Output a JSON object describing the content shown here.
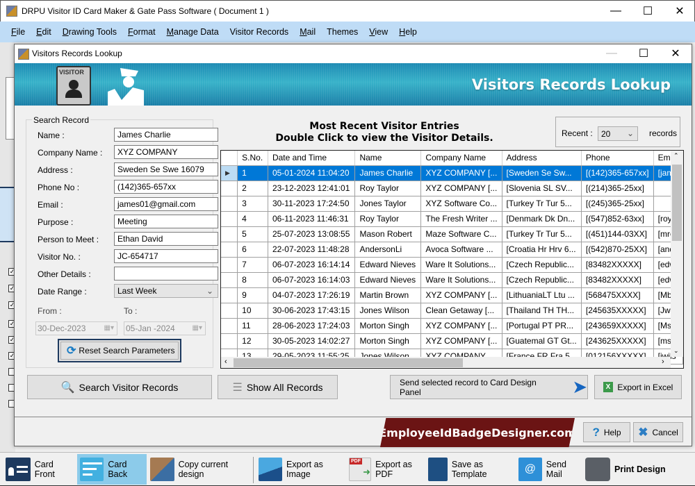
{
  "app": {
    "title": "DRPU Visitor ID Card Maker & Gate Pass Software ( Document 1 )",
    "menu": [
      {
        "label": "File",
        "hotkey": "F",
        "rest": "ile"
      },
      {
        "label": "Edit",
        "hotkey": "E",
        "rest": "dit"
      },
      {
        "label": "Drawing Tools",
        "hotkey": "D",
        "rest": "rawing Tools"
      },
      {
        "label": "Format",
        "hotkey": "F",
        "rest": "ormat"
      },
      {
        "label": "Manage Data",
        "hotkey": "M",
        "rest": "anage Data"
      },
      {
        "label": "Visitor Records",
        "hotkey": "",
        "rest": "Visitor Records"
      },
      {
        "label": "Mail",
        "hotkey": "M",
        "rest": "ail"
      },
      {
        "label": "Themes",
        "hotkey": "",
        "rest": "Themes"
      },
      {
        "label": "View",
        "hotkey": "V",
        "rest": "iew"
      },
      {
        "label": "Help",
        "hotkey": "H",
        "rest": "elp"
      }
    ]
  },
  "dialog": {
    "title": "Visitors Records Lookup",
    "banner_title": "Visitors Records Lookup",
    "banner_badge_label": "VISITOR"
  },
  "search": {
    "legend": "Search Record",
    "fields": [
      {
        "label": "Name :",
        "value": "James Charlie"
      },
      {
        "label": "Company Name :",
        "value": "XYZ COMPANY"
      },
      {
        "label": "Address :",
        "value": "Sweden Se Swe 16079"
      },
      {
        "label": "Phone No :",
        "value": "(142)365-657xx"
      },
      {
        "label": "Email :",
        "value": "james01@gmail.com"
      },
      {
        "label": "Purpose :",
        "value": "Meeting"
      },
      {
        "label": "Person to Meet :",
        "value": "Ethan David"
      },
      {
        "label": "Visitor No. :",
        "value": "JC-654717"
      },
      {
        "label": "Other Details :",
        "value": ""
      }
    ],
    "date_range_label": "Date Range :",
    "date_range_value": "Last Week",
    "from_label": "From :",
    "to_label": "To :",
    "from_date": "30-Dec-2023",
    "to_date": "05-Jan -2024",
    "reset_label": "Reset Search Parameters"
  },
  "results": {
    "heading_line1": "Most Recent Visitor Entries",
    "heading_line2": "Double Click to view the Visitor Details.",
    "recent_label": "Recent :",
    "recent_value": "20",
    "records_label": "records",
    "columns": [
      "S.No.",
      "Date and Time",
      "Name",
      "Company Name",
      "Address",
      "Phone",
      "Ema"
    ],
    "rows": [
      [
        "1",
        "05-01-2024 11:04:20",
        "James Charlie",
        "XYZ COMPANY [...",
        "[Sweden Se Sw...",
        "[(142)365-657xx]",
        "[jame"
      ],
      [
        "2",
        "23-12-2023 12:41:01",
        "Roy Taylor",
        "XYZ COMPANY [...",
        "[Slovenia SL SV...",
        "[(214)365-25xx]",
        ""
      ],
      [
        "3",
        "30-11-2023 17:24:50",
        "Jones Taylor",
        "XYZ Software Co...",
        "[Turkey Tr Tur 5...",
        "[(245)365-25xx]",
        ""
      ],
      [
        "4",
        "06-11-2023 11:46:31",
        "Roy Taylor",
        "The Fresh Writer ...",
        "[Denmark Dk Dn...",
        "[(547)852-63xx]",
        "[royt"
      ],
      [
        "5",
        "25-07-2023 13:08:55",
        "Mason Robert",
        "Maze Software C...",
        "[Turkey Tr Tur 5...",
        "[(451)144-03XX]",
        "[mro"
      ],
      [
        "6",
        "22-07-2023 11:48:28",
        "AndersonLi",
        "Avoca Software ...",
        "[Croatia Hr Hrv 6...",
        "[(542)870-25XX]",
        "[and"
      ],
      [
        "7",
        "06-07-2023 16:14:14",
        "Edward Nieves",
        "Ware It Solutions...",
        "[Czech Republic...",
        "[83482XXXXX]",
        "[edw"
      ],
      [
        "8",
        "06-07-2023 16:14:03",
        "Edward Nieves",
        "Ware It Solutions...",
        "[Czech Republic...",
        "[83482XXXXX]",
        "[edw"
      ],
      [
        "9",
        "04-07-2023 17:26:19",
        "Martin Brown",
        "XYZ COMPANY [...",
        "[LithuaniaLT Ltu ...",
        "[568475XXXX]",
        "[Mbr"
      ],
      [
        "10",
        "30-06-2023 17:43:15",
        "Jones Wilson",
        "Clean Getaway [...",
        "[Thailand TH TH...",
        "[245635XXXXX]",
        "[Jwil"
      ],
      [
        "11",
        "28-06-2023 17:24:03",
        "Morton Singh",
        "XYZ COMPANY [...",
        "[Portugal PT PR...",
        "[243659XXXXX]",
        "[Msi"
      ],
      [
        "12",
        "30-05-2023 14:02:27",
        "Morton Singh",
        "XYZ COMPANY [...",
        "[Guatemal GT Gt...",
        "[243625XXXXX]",
        "[msi"
      ],
      [
        "13",
        "29-05-2023 11:55:25",
        "Jones Wilson",
        "XYZ COMPANY...",
        "[France FR Fra 5...",
        "[012156XXXXX]",
        "[jwils"
      ]
    ],
    "selected_row": 0
  },
  "actions": {
    "search_label": "Search Visitor Records",
    "show_all_label": "Show All Records",
    "send_label": "Send selected record to Card Design Panel",
    "export_excel_label": "Export in Excel",
    "promo_text": "EmployeeIdBadgeDesigner.com",
    "help_label": "Help",
    "cancel_label": "Cancel"
  },
  "toolbar": {
    "items": [
      {
        "label": "Card Front",
        "icon": "card-front-icon"
      },
      {
        "label": "Card Back",
        "icon": "card-back-icon",
        "active": true
      },
      {
        "label": "Copy current design",
        "icon": "copy-design-icon"
      },
      {
        "label": "Export as Image",
        "icon": "export-image-icon"
      },
      {
        "label": "Export as PDF",
        "icon": "export-pdf-icon"
      },
      {
        "label": "Save as Template",
        "icon": "save-template-icon"
      },
      {
        "label": "Send Mail",
        "icon": "send-mail-icon"
      },
      {
        "label": "Print Design",
        "icon": "print-icon"
      }
    ]
  },
  "colors": {
    "menubar": "#bfdcf6",
    "selection": "#0078d7",
    "promo": "#6b1414",
    "banner": "#1d8ab3"
  }
}
